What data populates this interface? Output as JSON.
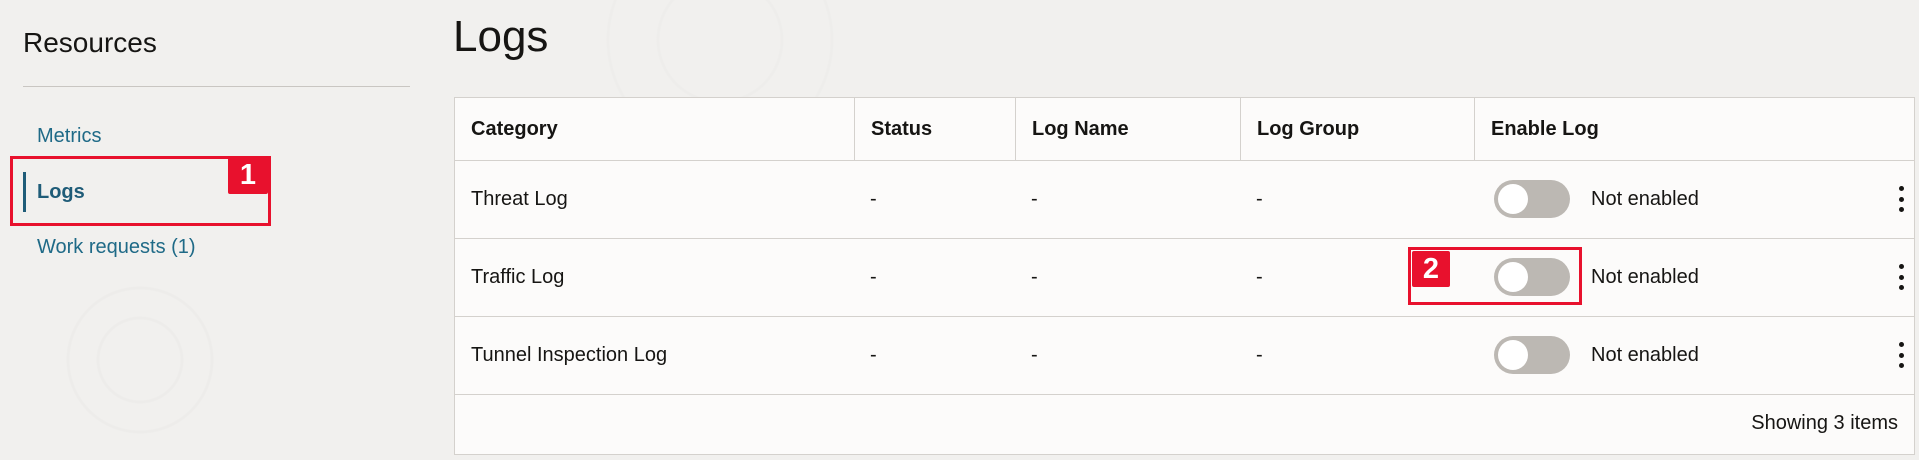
{
  "sidebar": {
    "title": "Resources",
    "items": [
      {
        "label": "Metrics"
      },
      {
        "label": "Logs"
      },
      {
        "label": "Work requests (1)"
      }
    ]
  },
  "annotations": {
    "badge1": "1",
    "badge2": "2",
    "highlight_color": "#e8112d"
  },
  "main": {
    "title": "Logs",
    "table": {
      "columns": [
        "Category",
        "Status",
        "Log Name",
        "Log Group",
        "Enable Log"
      ],
      "rows": [
        {
          "category": "Threat Log",
          "status": "-",
          "log_name": "-",
          "log_group": "-",
          "enable_state": "Not enabled",
          "enabled": false
        },
        {
          "category": "Traffic Log",
          "status": "-",
          "log_name": "-",
          "log_group": "-",
          "enable_state": "Not enabled",
          "enabled": false
        },
        {
          "category": "Tunnel Inspection Log",
          "status": "-",
          "log_name": "-",
          "log_group": "-",
          "enable_state": "Not enabled",
          "enabled": false
        }
      ],
      "footer": "Showing 3 items"
    }
  },
  "icons": {
    "row_actions": "kebab-menu-icon"
  },
  "colors": {
    "link": "#1f6a87",
    "toggle_off": "#bcb8b3"
  }
}
